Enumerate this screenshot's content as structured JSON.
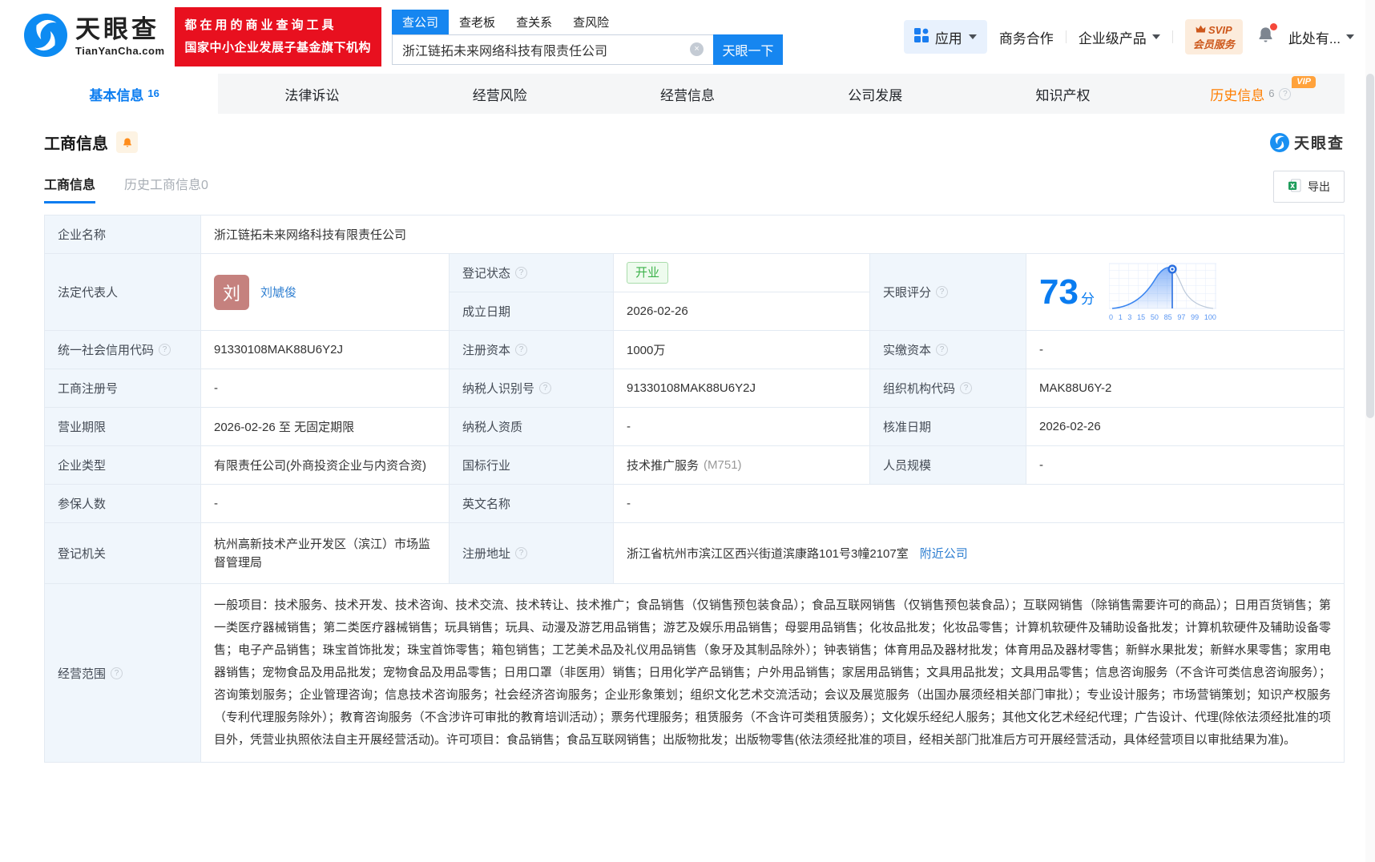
{
  "colors": {
    "accent_blue": "#0a7cf0",
    "brand_red": "#e8101f",
    "status_green": "#3cb24a",
    "vip_orange": "#ffa23c",
    "link_blue": "#2f7fd1"
  },
  "icons": {
    "clear_glyph": "×",
    "help_glyph": "?"
  },
  "header": {
    "logo": {
      "title": "天眼查",
      "subtitle": "TianYanCha.com"
    },
    "slogan": {
      "line1": "都在用的商业查询工具",
      "line2": "国家中小企业发展子基金旗下机构"
    },
    "search": {
      "tabs": [
        {
          "label": "查公司"
        },
        {
          "label": "查老板"
        },
        {
          "label": "查关系"
        },
        {
          "label": "查风险"
        }
      ],
      "value": "浙江链拓未来网络科技有限责任公司",
      "button": "天眼一下"
    },
    "apps_label": "应用",
    "cooperation": "商务合作",
    "enterprise": "企业级产品",
    "svip": {
      "line1": "SVIP",
      "line2": "会员服务"
    },
    "more": "此处有..."
  },
  "nav_tabs": [
    {
      "label": "基本信息",
      "count": "16"
    },
    {
      "label": "法律诉讼"
    },
    {
      "label": "经营风险"
    },
    {
      "label": "经营信息"
    },
    {
      "label": "公司发展"
    },
    {
      "label": "知识产权"
    },
    {
      "label": "历史信息",
      "count": "6",
      "badge": "VIP"
    }
  ],
  "section": {
    "title": "工商信息",
    "watermark": "天眼查",
    "subtab_active": "工商信息",
    "subtab_history": "历史工商信息0",
    "export_label": "导出"
  },
  "table": {
    "company_name": {
      "label": "企业名称",
      "value": "浙江链拓未来网络科技有限责任公司"
    },
    "legal_rep": {
      "label": "法定代表人",
      "avatar": "刘",
      "name": "刘虓俊"
    },
    "reg_status": {
      "label": "登记状态",
      "value": "开业"
    },
    "est_date": {
      "label": "成立日期",
      "value": "2026-02-26"
    },
    "score": {
      "label": "天眼评分",
      "value": "73",
      "unit": "分",
      "axis": [
        "0",
        "1",
        "3",
        "15",
        "50",
        "85",
        "97",
        "99",
        "100"
      ]
    },
    "credit_code": {
      "label": "统一社会信用代码",
      "value": "91330108MAK88U6Y2J"
    },
    "reg_capital": {
      "label": "注册资本",
      "value": "1000万"
    },
    "paid_capital": {
      "label": "实缴资本",
      "value": "-"
    },
    "reg_number": {
      "label": "工商注册号",
      "value": "-"
    },
    "taxpayer_id": {
      "label": "纳税人识别号",
      "value": "91330108MAK88U6Y2J"
    },
    "org_code": {
      "label": "组织机构代码",
      "value": "MAK88U6Y-2"
    },
    "business_term": {
      "label": "营业期限",
      "value": "2026-02-26 至 无固定期限"
    },
    "taxpayer_quality": {
      "label": "纳税人资质",
      "value": "-"
    },
    "approval_date": {
      "label": "核准日期",
      "value": "2026-02-26"
    },
    "company_type": {
      "label": "企业类型",
      "value": "有限责任公司(外商投资企业与内资合资)"
    },
    "industry": {
      "label": "国标行业",
      "value": "技术推广服务",
      "code": "(M751)"
    },
    "staff_size": {
      "label": "人员规模",
      "value": "-"
    },
    "insured_count": {
      "label": "参保人数",
      "value": "-"
    },
    "english_name": {
      "label": "英文名称",
      "value": "-"
    },
    "reg_authority": {
      "label": "登记机关",
      "value": "杭州高新技术产业开发区（滨江）市场监督管理局"
    },
    "reg_address": {
      "label": "注册地址",
      "value": "浙江省杭州市滨江区西兴街道滨康路101号3幢2107室",
      "link": "附近公司"
    },
    "business_scope": {
      "label": "经营范围",
      "value": "一般项目：技术服务、技术开发、技术咨询、技术交流、技术转让、技术推广；食品销售（仅销售预包装食品）；食品互联网销售（仅销售预包装食品）；互联网销售（除销售需要许可的商品）；日用百货销售；第一类医疗器械销售；第二类医疗器械销售；玩具销售；玩具、动漫及游艺用品销售；游艺及娱乐用品销售；母婴用品销售；化妆品批发；化妆品零售；计算机软硬件及辅助设备批发；计算机软硬件及辅助设备零售；电子产品销售；珠宝首饰批发；珠宝首饰零售；箱包销售；工艺美术品及礼仪用品销售（象牙及其制品除外）；钟表销售；体育用品及器材批发；体育用品及器材零售；新鲜水果批发；新鲜水果零售；家用电器销售；宠物食品及用品批发；宠物食品及用品零售；日用口罩（非医用）销售；日用化学产品销售；户外用品销售；家居用品销售；文具用品批发；文具用品零售；信息咨询服务（不含许可类信息咨询服务）；咨询策划服务；企业管理咨询；信息技术咨询服务；社会经济咨询服务；企业形象策划；组织文化艺术交流活动；会议及展览服务（出国办展须经相关部门审批）；专业设计服务；市场营销策划；知识产权服务（专利代理服务除外）；教育咨询服务（不含涉许可审批的教育培训活动）；票务代理服务；租赁服务（不含许可类租赁服务）；文化娱乐经纪人服务；其他文化艺术经纪代理；广告设计、代理(除依法须经批准的项目外，凭营业执照依法自主开展经营活动)。许可项目：食品销售；食品互联网销售；出版物批发；出版物零售(依法须经批准的项目，经相关部门批准后方可开展经营活动，具体经营项目以审批结果为准)。"
    }
  }
}
